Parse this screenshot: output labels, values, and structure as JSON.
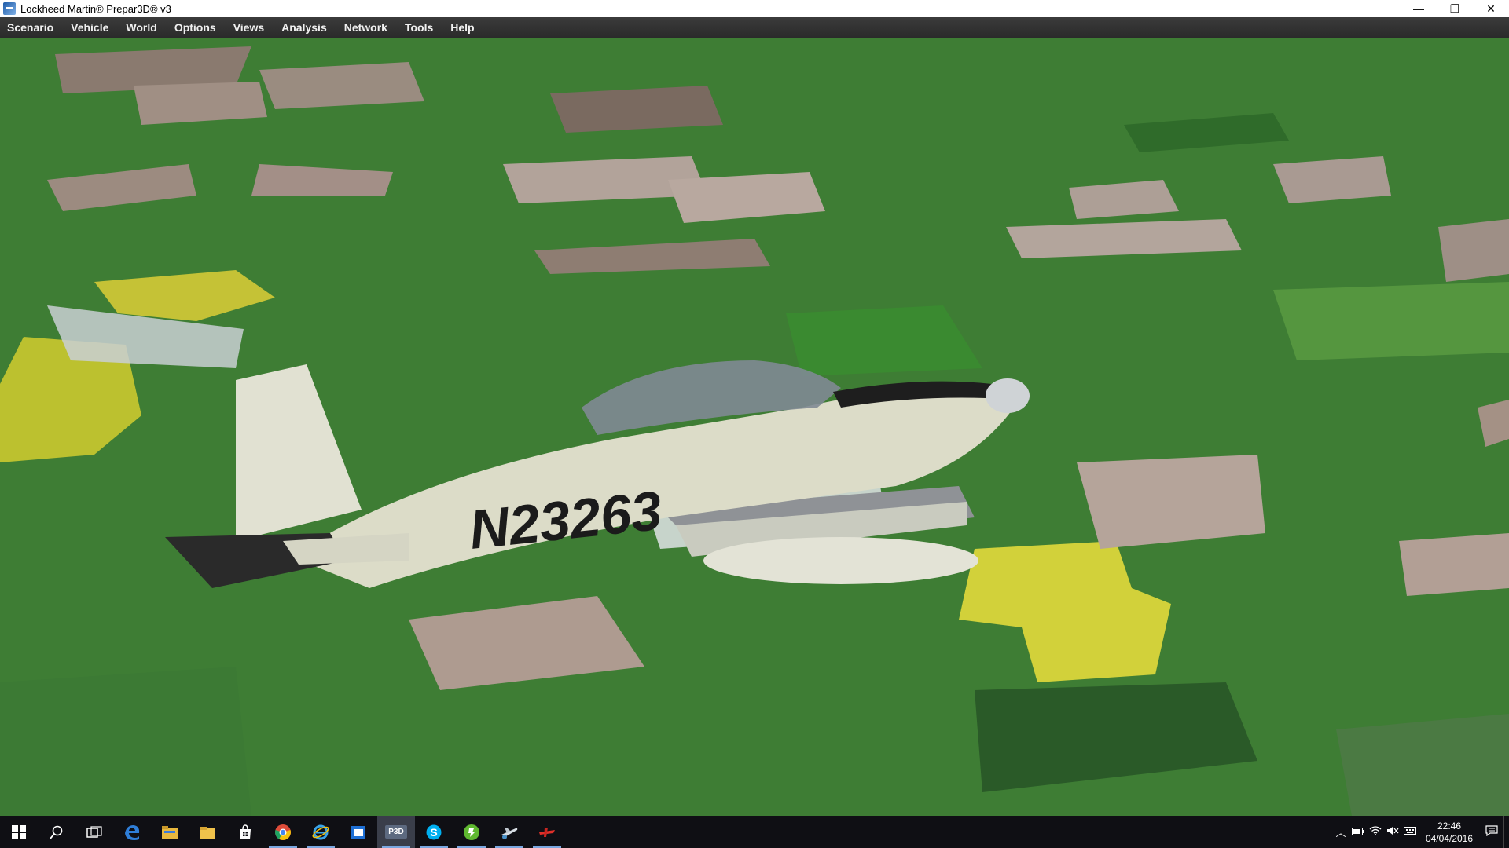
{
  "window": {
    "title": "Lockheed Martin® Prepar3D® v3",
    "minimize": "—",
    "restore": "❐",
    "close": "✕"
  },
  "menu": {
    "items": [
      {
        "label": "Scenario",
        "name": "menu-scenario"
      },
      {
        "label": "Vehicle",
        "name": "menu-vehicle"
      },
      {
        "label": "World",
        "name": "menu-world"
      },
      {
        "label": "Options",
        "name": "menu-options"
      },
      {
        "label": "Views",
        "name": "menu-views"
      },
      {
        "label": "Analysis",
        "name": "menu-analysis"
      },
      {
        "label": "Network",
        "name": "menu-network"
      },
      {
        "label": "Tools",
        "name": "menu-tools"
      },
      {
        "label": "Help",
        "name": "menu-help"
      }
    ]
  },
  "scene": {
    "aircraft_registration": "N23263"
  },
  "taskbar": {
    "p3d_label": "P3D",
    "icons": [
      "start-icon",
      "search-icon",
      "task-view-icon",
      "edge-icon",
      "file-explorer-icon",
      "folder-icon",
      "store-icon",
      "chrome-icon",
      "internet-explorer-icon",
      "app-window-icon",
      "prepar3d-icon",
      "skype-icon",
      "green-app-icon",
      "plane-app-icon",
      "red-app-icon"
    ],
    "clock_time": "22:46",
    "clock_date": "04/04/2016"
  },
  "colors": {
    "titlebar_bg": "#ffffff",
    "menubar_bg": "#2f2f2f",
    "taskbar_bg": "#0f0f14",
    "aircraft_body": "#dcdcc8"
  }
}
